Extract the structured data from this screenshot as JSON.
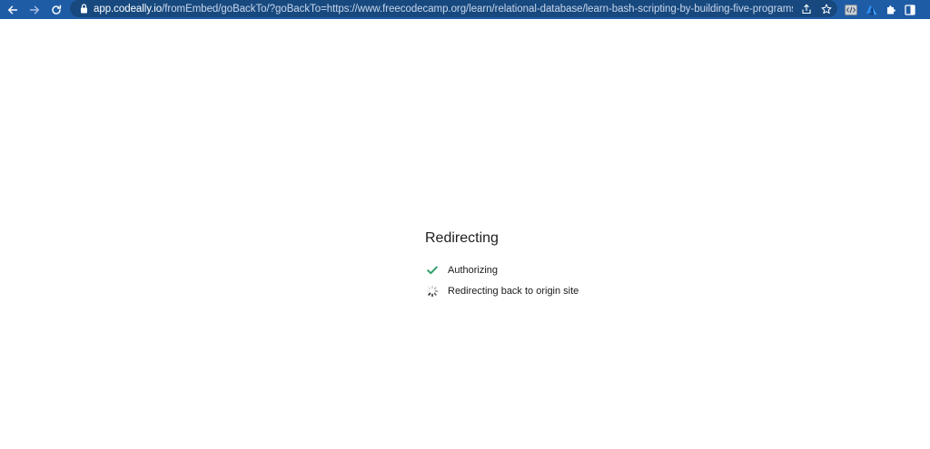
{
  "browser": {
    "url_host": "app.codeally.io",
    "url_path": "/fromEmbed/goBackTo/?goBackTo=https://www.freecodecamp.org/learn/relational-database/learn-bash-scripting-by-building-five-programs/build-five-pr...",
    "toolbar_color": "#1f5ca6",
    "omnibox_color": "#17497f",
    "icons": [
      "back-arrow-icon",
      "forward-arrow-icon",
      "reload-icon",
      "lock-icon",
      "share-icon",
      "star-icon",
      "code-extension-icon",
      "azure-extension-icon",
      "puzzle-icon",
      "sidepanel-icon"
    ]
  },
  "page": {
    "title": "Redirecting",
    "steps": [
      {
        "label": "Authorizing",
        "status": "done",
        "icon": "check-icon",
        "color": "#2e9e6a"
      },
      {
        "label": "Redirecting back to origin site",
        "status": "in-progress",
        "icon": "spinner-icon"
      }
    ]
  }
}
